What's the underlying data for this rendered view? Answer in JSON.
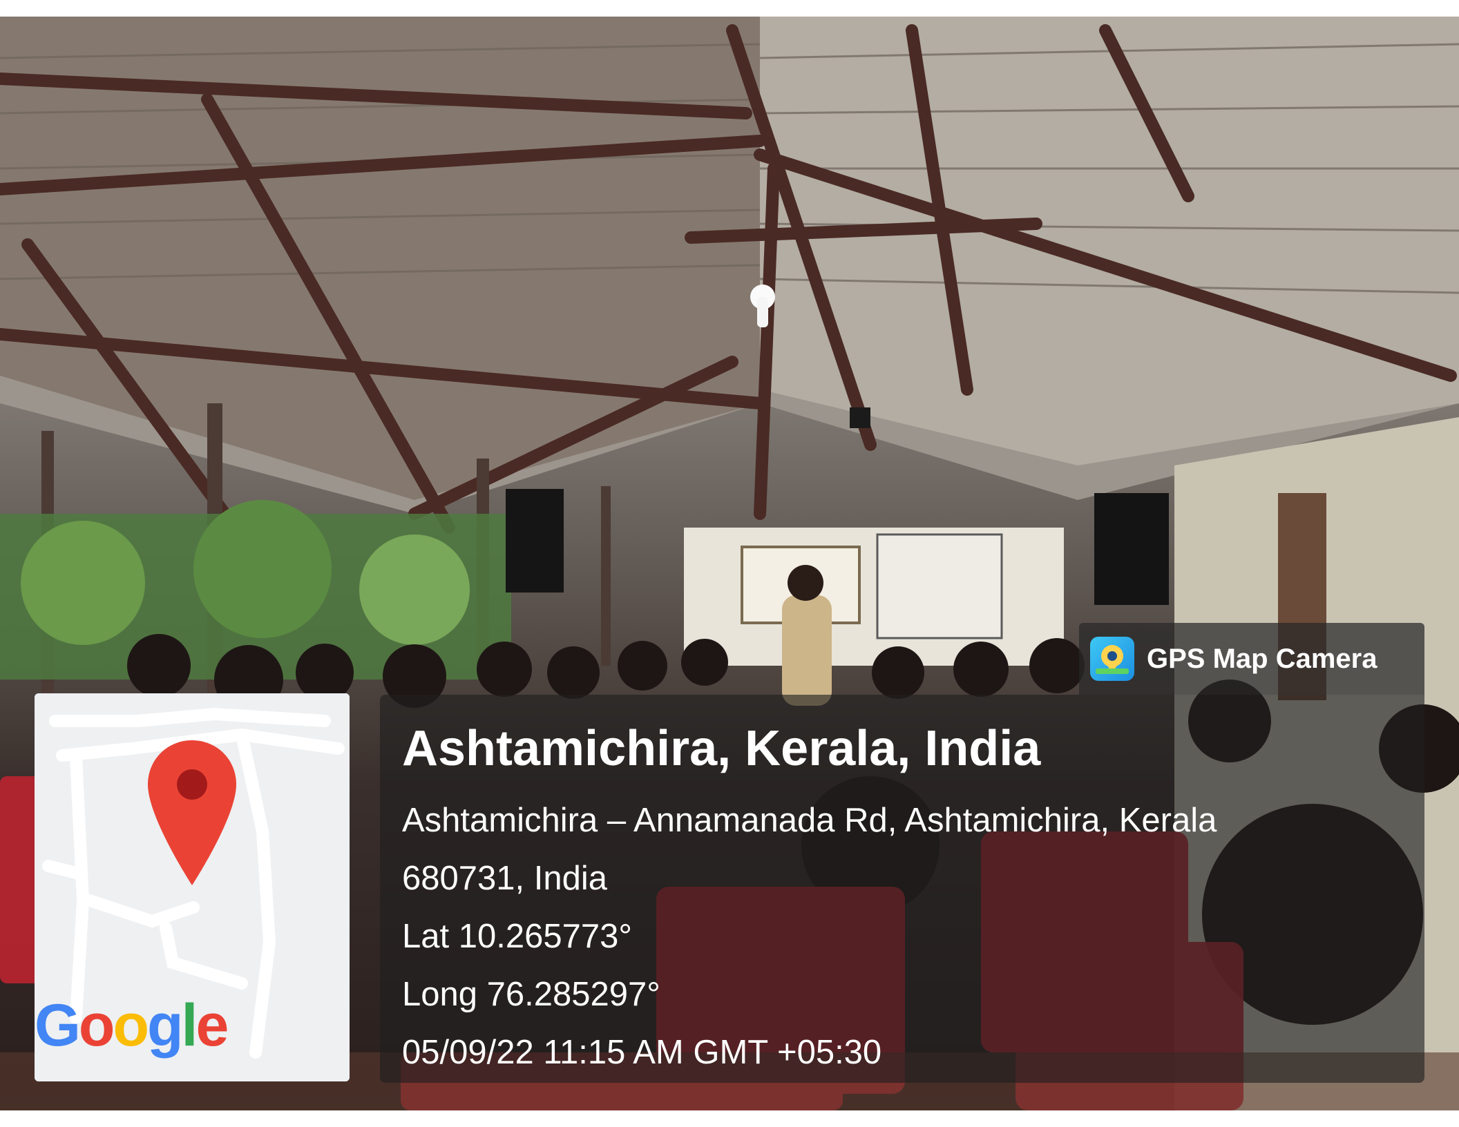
{
  "gps_badge": {
    "app_name": "GPS Map Camera",
    "icon": "map-pin-camera-icon"
  },
  "location": {
    "title": "Ashtamichira, Kerala, India",
    "address_line1": "Ashtamichira – Annamanada Rd, Ashtamichira, Kerala",
    "address_line2": "680731, India",
    "latitude": "Lat 10.265773°",
    "longitude": "Long 76.285297°",
    "datetime": "05/09/22 11:15 AM GMT +05:30"
  },
  "map": {
    "marker_icon": "location-pin-icon",
    "logo": {
      "letters": [
        "G",
        "o",
        "o",
        "g",
        "l",
        "e"
      ],
      "colors": [
        "#4285f4",
        "#ea4335",
        "#fbbc05",
        "#4285f4",
        "#34a853",
        "#ea4335"
      ]
    }
  },
  "colors": {
    "overlay": "#1e1e1e",
    "pin": "#ea4335",
    "chair": "#c0252f"
  }
}
